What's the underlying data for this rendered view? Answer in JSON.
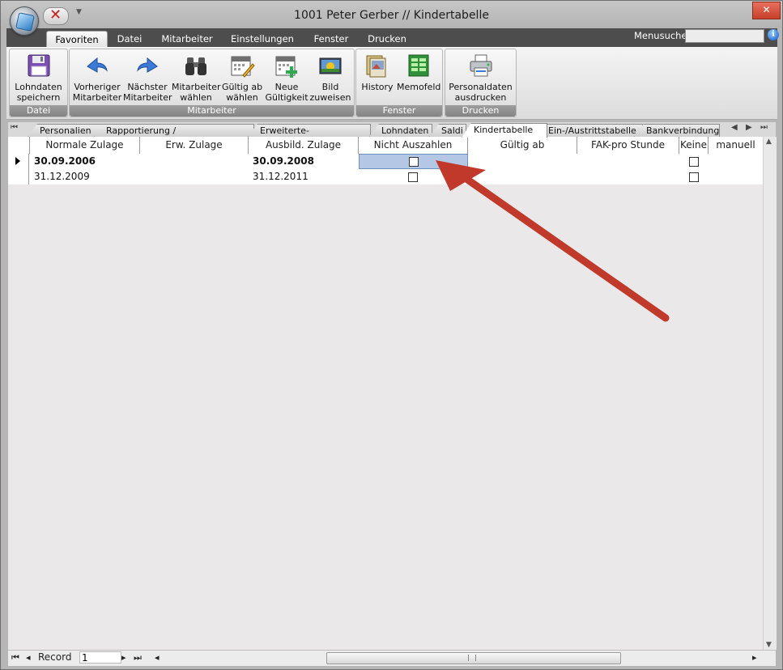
{
  "window": {
    "title": "1001 Peter Gerber // Kindertabelle",
    "close_label": "✕"
  },
  "ribbon_tabs": [
    "Favoriten",
    "Datei",
    "Mitarbeiter",
    "Einstellungen",
    "Fenster",
    "Drucken"
  ],
  "menusuche": {
    "label": "Menusuche",
    "value": "",
    "info": "i"
  },
  "ribbon": {
    "groups": [
      {
        "label": "Datei",
        "buttons": [
          {
            "line1": "Lohndaten",
            "line2": "speichern",
            "icon": "floppy-disk-icon"
          }
        ]
      },
      {
        "label": "Mitarbeiter",
        "buttons": [
          {
            "line1": "Vorheriger",
            "line2": "Mitarbeiter",
            "icon": "arrow-left-icon"
          },
          {
            "line1": "Nächster",
            "line2": "Mitarbeiter",
            "icon": "arrow-right-icon"
          },
          {
            "line1": "Mitarbeiter",
            "line2": "wählen",
            "icon": "binoculars-icon"
          },
          {
            "line1": "Gültig ab",
            "line2": "wählen",
            "icon": "calendar-pencil-icon"
          },
          {
            "line1": "Neue",
            "line2": "Gültigkeit",
            "icon": "calendar-add-icon"
          },
          {
            "line1": "Bild",
            "line2": "zuweisen",
            "icon": "picture-icon"
          }
        ]
      },
      {
        "label": "Fenster",
        "buttons": [
          {
            "line1": "History",
            "line2": "",
            "icon": "history-icon"
          },
          {
            "line1": "Memofeld",
            "line2": "",
            "icon": "memo-grid-icon"
          }
        ]
      },
      {
        "label": "Drucken",
        "buttons": [
          {
            "line1": "Personaldaten",
            "line2": "ausdrucken",
            "icon": "printer-icon"
          }
        ]
      }
    ]
  },
  "subtabs": [
    "Personalien",
    "Rapportierung / Kostenrechnung",
    "Erweiterte-Personaldaten",
    "Lohndaten",
    "Saldi",
    "Kindertabelle",
    "Ein-/Austrittstabelle",
    "Bankverbindung"
  ],
  "active_subtab": "Kindertabelle",
  "table": {
    "columns": [
      "Normale Zulage",
      "Erw. Zulage",
      "Ausbild. Zulage",
      "Nicht Auszahlen",
      "Gültig ab",
      "FAK-pro Stunde",
      "Keine",
      "manuell"
    ],
    "rows": [
      {
        "normale_zulage": "30.09.2006",
        "erw_zulage": "",
        "ausbild_zulage": "30.09.2008",
        "nicht_auszahlen": false,
        "gueltig_ab": "",
        "fak_pro_stunde": "",
        "keine": false,
        "manuell": ""
      },
      {
        "normale_zulage": "31.12.2009",
        "erw_zulage": "",
        "ausbild_zulage": "31.12.2011",
        "nicht_auszahlen": false,
        "gueltig_ab": "",
        "fak_pro_stunde": "",
        "keine": false,
        "manuell": ""
      }
    ]
  },
  "record_nav": {
    "label": "Record",
    "value": "1"
  },
  "colors": {
    "annotation_arrow": "#c0392b",
    "selected_cell": "#b4c8e6"
  }
}
